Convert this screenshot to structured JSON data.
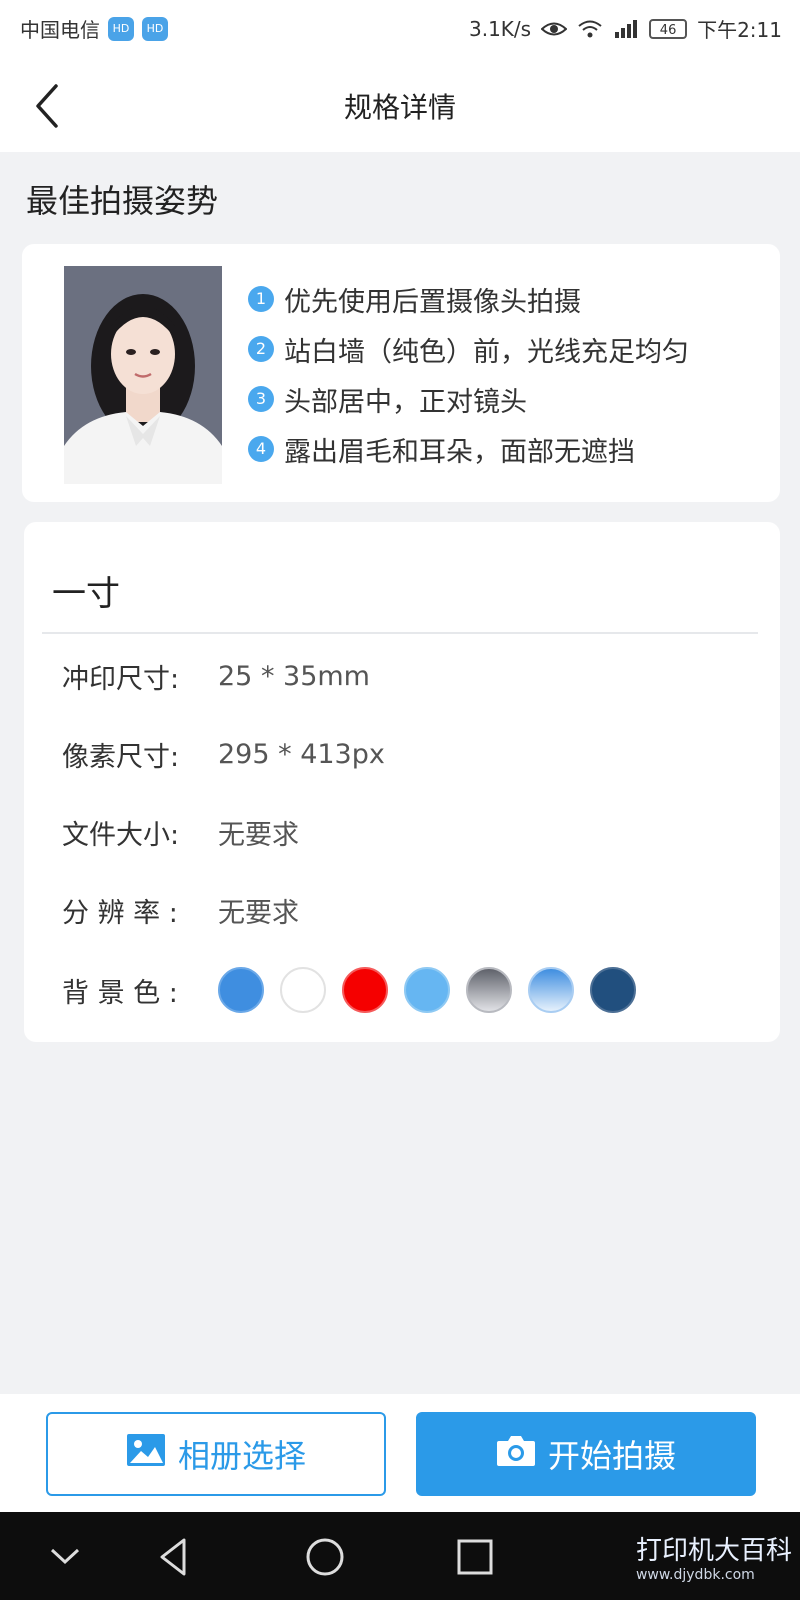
{
  "status_bar": {
    "carrier": "中国电信",
    "hd_badge": "HD",
    "speed": "3.1K/s",
    "battery": "46",
    "time": "下午2:11"
  },
  "header": {
    "title": "规格详情"
  },
  "pose_section": {
    "title": "最佳拍摄姿势",
    "tips": [
      {
        "num": "1",
        "text": "优先使用后置摄像头拍摄"
      },
      {
        "num": "2",
        "text": "站白墙（纯色）前，光线充足均匀"
      },
      {
        "num": "3",
        "text": "头部居中，正对镜头"
      },
      {
        "num": "4",
        "text": "露出眉毛和耳朵，面部无遮挡"
      }
    ]
  },
  "spec": {
    "name": "一寸",
    "rows": [
      {
        "label": "冲印尺寸:",
        "value": "25 * 35mm"
      },
      {
        "label": "像素尺寸:",
        "value": "295 * 413px"
      },
      {
        "label": "文件大小:",
        "value": "无要求"
      },
      {
        "label": "分 辨 率 :",
        "value": "无要求"
      }
    ],
    "bg_label": "背 景 色 :",
    "bg_colors": [
      "#3f8ee0",
      "#ffffff",
      "#f50000",
      "#66b6f2",
      "gradient-gray",
      "gradient-blue",
      "#214f7e"
    ]
  },
  "actions": {
    "album_label": "相册选择",
    "camera_label": "开始拍摄"
  },
  "watermark": {
    "main": "打印机大百科",
    "sub": "www.djydbk.com"
  },
  "colors": {
    "primary": "#2b9ae8",
    "tip_badge": "#4aa8ee",
    "page_bg": "#f1f2f4"
  }
}
